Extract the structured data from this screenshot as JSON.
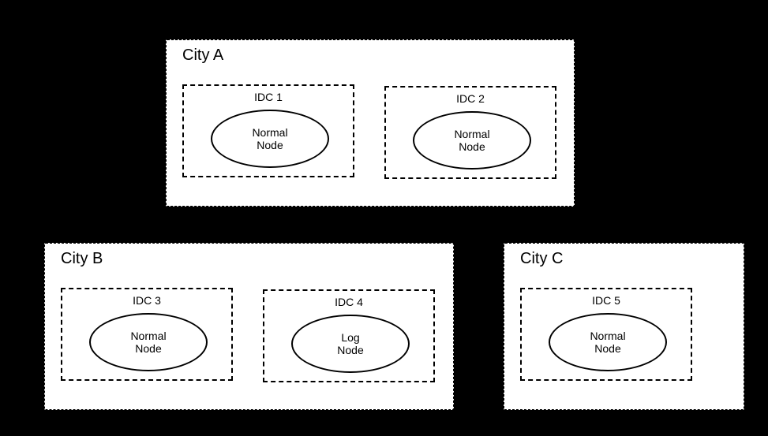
{
  "cities": {
    "a": {
      "title": "City A",
      "idcs": {
        "idc1": {
          "title": "IDC 1",
          "node": "Normal\nNode"
        },
        "idc2": {
          "title": "IDC 2",
          "node": "Normal\nNode"
        }
      }
    },
    "b": {
      "title": "City B",
      "idcs": {
        "idc3": {
          "title": "IDC 3",
          "node": "Normal\nNode"
        },
        "idc4": {
          "title": "IDC 4",
          "node": "Log\nNode"
        }
      }
    },
    "c": {
      "title": "City C",
      "idcs": {
        "idc5": {
          "title": "IDC 5",
          "node": "Normal\nNode"
        }
      }
    }
  }
}
